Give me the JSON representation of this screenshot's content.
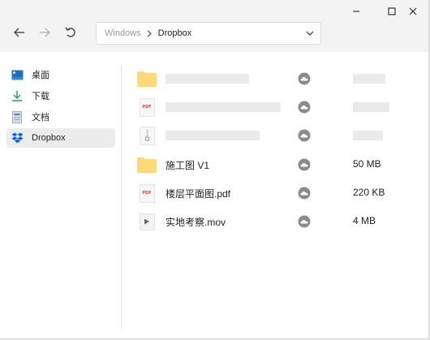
{
  "window": {
    "controls": {
      "minimize": "minimize-icon",
      "maximize": "maximize-icon",
      "close": "close-icon"
    }
  },
  "toolbar": {
    "back_icon": "arrow-left-icon",
    "forward_icon": "arrow-right-icon",
    "refresh_icon": "undo-icon",
    "breadcrumb": {
      "root": "Windows",
      "current": "Dropbox"
    }
  },
  "sidebar": {
    "items": [
      {
        "label": "桌面",
        "icon": "desktop-icon"
      },
      {
        "label": "下载",
        "icon": "download-icon"
      },
      {
        "label": "文档",
        "icon": "document-icon"
      },
      {
        "label": "Dropbox",
        "icon": "dropbox-icon",
        "active": true
      }
    ]
  },
  "files": [
    {
      "name": "施工图 V1",
      "type": "folder",
      "size": "50 MB",
      "sync_icon": "cloud-icon"
    },
    {
      "name": "楼层平面图.pdf",
      "type": "pdf",
      "size": "220 KB",
      "sync_icon": "cloud-icon"
    },
    {
      "name": "实地考察.mov",
      "type": "video",
      "size": "4 MB",
      "sync_icon": "cloud-icon"
    }
  ],
  "icon_labels": {
    "pdf": "PDF"
  },
  "colors": {
    "folder": "#ffd978",
    "dropbox": "#0061fe",
    "download": "#1fa463",
    "cloud": "#8a8a8a"
  }
}
